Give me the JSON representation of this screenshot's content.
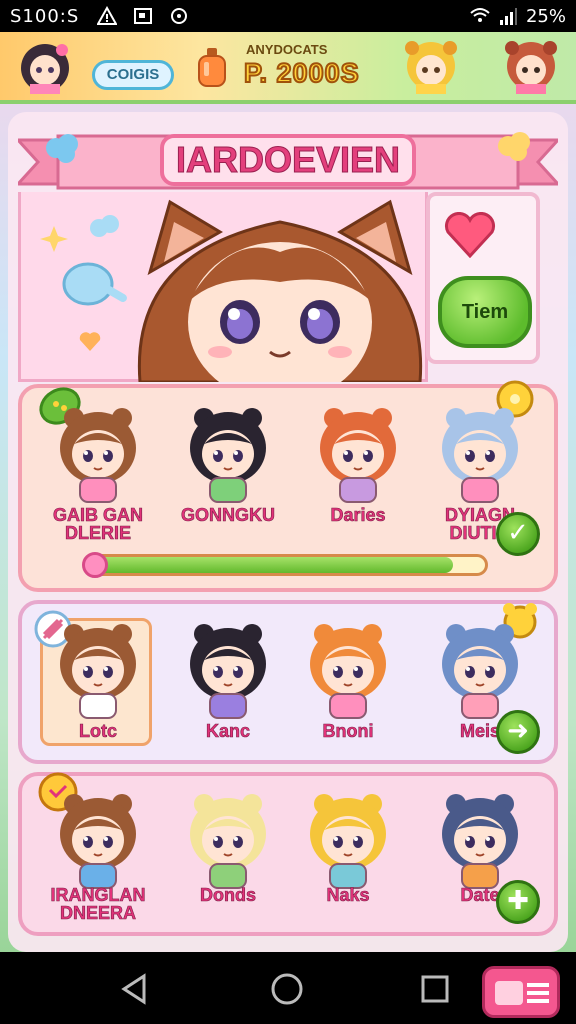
{
  "status_bar": {
    "time": "S100:S",
    "battery": "25%"
  },
  "top_bar": {
    "coins_label": "COIGIS",
    "score_caption": "ANYDOCATS",
    "score_value": "P. 2000S"
  },
  "banner": {
    "title": "IARDOEVIEN"
  },
  "side_panel": {
    "item_button_label": "Tiem"
  },
  "roster": {
    "row1": {
      "characters": [
        {
          "label": "GAIB GAN\nDLERIE"
        },
        {
          "label": "GONNGKU"
        },
        {
          "label": "Daries"
        },
        {
          "label": "DYIAGN\nDIUTIG"
        }
      ],
      "progress": 0.92
    },
    "row2": {
      "characters": [
        {
          "label": "Lotc"
        },
        {
          "label": "Kanc"
        },
        {
          "label": "Bnoni"
        },
        {
          "label": "Meis"
        }
      ]
    },
    "row3": {
      "characters": [
        {
          "label": "IRANGLAN\nDNEERA"
        },
        {
          "label": "Donds"
        },
        {
          "label": "Naks"
        },
        {
          "label": "Date"
        }
      ]
    }
  },
  "colors": {
    "accent_pink": "#e33f7c",
    "confirm_green": "#4ba51e",
    "hair_brown": "#a9582f"
  }
}
